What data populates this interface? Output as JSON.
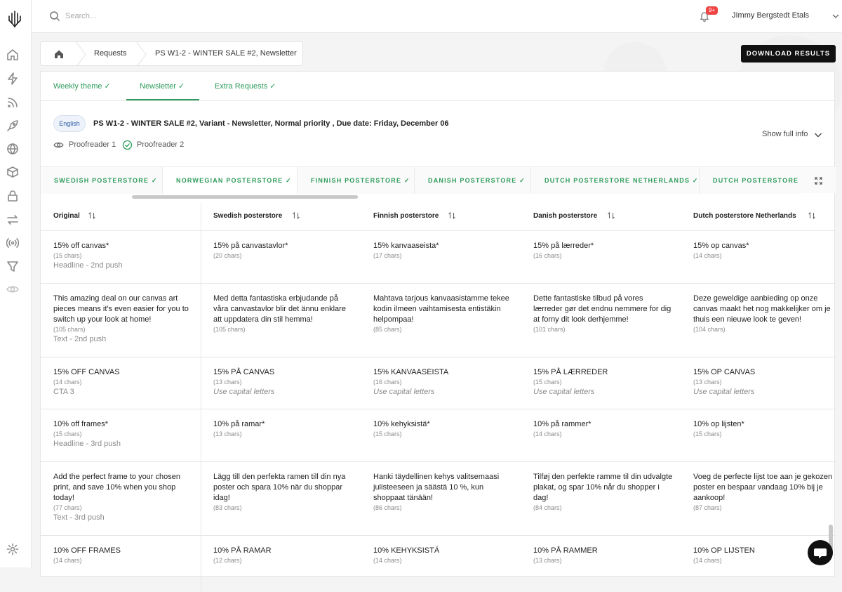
{
  "topbar": {
    "search_placeholder": "Search...",
    "notification_badge": "9+",
    "user_name": "JImmy Bergstedt Etals"
  },
  "breadcrumb": {
    "items": [
      "Requests",
      "PS W1-2 - WINTER SALE #2, Newsletter"
    ]
  },
  "actions": {
    "download_label": "DOWNLOAD RESULTS"
  },
  "tabs": [
    {
      "label": "Weekly theme  ✓"
    },
    {
      "label": "Newsletter  ✓"
    },
    {
      "label": "Extra Requests  ✓"
    }
  ],
  "request": {
    "language": "English",
    "title": "PS W1-2 - WINTER SALE #2, Variant - Newsletter, Normal priority , Due date: Friday, December 06",
    "proofreader1": "Proofreader 1",
    "proofreader2": "Proofreader 2",
    "show_full_info": "Show full info"
  },
  "store_tabs": [
    "SWEDISH POSTERSTORE ✓",
    "NORWEGIAN POSTERSTORE ✓",
    "FINNISH POSTERSTORE ✓",
    "DANISH POSTERSTORE ✓",
    "DUTCH POSTERSTORE NETHERLANDS ✓",
    "DUTCH POSTERSTORE BE"
  ],
  "table": {
    "columns": [
      "Original",
      "Swedish posterstore",
      "Finnish posterstore",
      "Danish posterstore",
      "Dutch posterstore Netherlands"
    ],
    "rows": [
      {
        "cells": [
          {
            "text": "15% off canvas*",
            "chars": "(15 chars)",
            "note": "Headline - 2nd push"
          },
          {
            "text": "15% på canvastavlor*",
            "chars": "(20 chars)"
          },
          {
            "text": "15% kanvaaseista*",
            "chars": "(17 chars)"
          },
          {
            "text": "15% på lærreder*",
            "chars": "(16 chars)"
          },
          {
            "text": "15% op canvas*",
            "chars": "(14 chars)"
          }
        ]
      },
      {
        "cells": [
          {
            "text": "This amazing deal on our canvas art pieces means it's even easier for you to switch up your look at home!",
            "chars": "(105 chars)",
            "note": "Text - 2nd push"
          },
          {
            "text": "Med detta fantastiska erbjudande på våra canvastavlor blir det ännu enklare att uppdatera din stil hemma!",
            "chars": "(105 chars)"
          },
          {
            "text": "Mahtava tarjous kanvaasistamme tekee kodin ilmeen vaihtamisesta entistäkin helpompaa!",
            "chars": "(85 chars)"
          },
          {
            "text": "Dette fantastiske tilbud på vores lærreder gør det endnu nemmere for dig at forny dit look derhjemme!",
            "chars": "(101 chars)"
          },
          {
            "text": "Deze geweldige aanbieding op onze canvas maakt het nog makkelijker om je thuis een nieuwe look te geven!",
            "chars": "(104 chars)"
          }
        ]
      },
      {
        "cells": [
          {
            "text": "15% OFF CANVAS",
            "chars": "(14 chars)",
            "note": "CTA 3"
          },
          {
            "text": "15% PÅ CANVAS",
            "chars": "(13 chars)",
            "hint": "Use capital letters"
          },
          {
            "text": "15% KANVAASEISTA",
            "chars": "(16 chars)",
            "hint": "Use capital letters"
          },
          {
            "text": "15% PÅ LÆRREDER",
            "chars": "(15 chars)",
            "hint": "Use capital letters"
          },
          {
            "text": "15% OP CANVAS",
            "chars": "(13 chars)",
            "hint": "Use capital letters"
          }
        ]
      },
      {
        "cells": [
          {
            "text": "10% off frames*",
            "chars": "(15 chars)",
            "note": "Headline - 3rd push"
          },
          {
            "text": "10% på ramar*",
            "chars": "(13 chars)"
          },
          {
            "text": "10% kehyksistä*",
            "chars": "(15 chars)"
          },
          {
            "text": "10% på rammer*",
            "chars": "(14 chars)"
          },
          {
            "text": "10% op lijsten*",
            "chars": "(15 chars)"
          }
        ]
      },
      {
        "cells": [
          {
            "text": "Add the perfect frame to your chosen print, and save 10% when you shop today!",
            "chars": "(77 chars)",
            "note": "Text - 3rd push"
          },
          {
            "text": "Lägg till den perfekta ramen till din nya poster och spara 10% när du shoppar idag!",
            "chars": "(83 chars)"
          },
          {
            "text": "Hanki täydellinen kehys valitsemaasi julisteeseen ja säästä 10 %, kun shoppaat tänään!",
            "chars": "(86 chars)"
          },
          {
            "text": "Tilføj den perfekte ramme til din udvalgte plakat, og spar 10% når du shopper i dag!",
            "chars": "(84 chars)"
          },
          {
            "text": "Voeg de perfecte lijst toe aan je gekozen poster en bespaar vandaag 10% bij je aankoop!",
            "chars": "(87 chars)"
          }
        ]
      },
      {
        "cells": [
          {
            "text": "10% OFF FRAMES",
            "chars": "(14 chars)"
          },
          {
            "text": "10% PÅ RAMAR",
            "chars": "(12 chars)"
          },
          {
            "text": "10% KEHYKSISTÄ",
            "chars": "(14 chars)"
          },
          {
            "text": "10% PÅ RAMMER",
            "chars": "(13 chars)"
          },
          {
            "text": "10% OP LIJSTEN",
            "chars": "(14 chars)"
          }
        ]
      }
    ]
  },
  "icons": [
    "logo-tree-icon",
    "home-icon",
    "bolt-icon",
    "rss-icon",
    "rocket-icon",
    "globe-icon",
    "cube-icon",
    "lock-icon",
    "transfer-icon",
    "broadcast-icon",
    "filter-icon",
    "eye-icon",
    "settings-icon",
    "search-icon",
    "bell-icon",
    "chevron-down-icon",
    "chat-icon"
  ],
  "colors": {
    "accent": "#2e9c5b",
    "primary_button": "#111111",
    "badge": "#ef4444"
  }
}
